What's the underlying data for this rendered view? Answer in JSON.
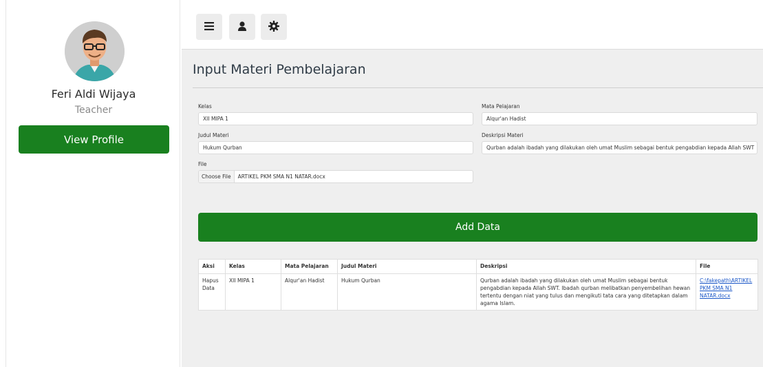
{
  "sidebar": {
    "user_name": "Feri Aldi Wijaya",
    "user_role": "Teacher",
    "view_profile_label": "View Profile",
    "avatar_icon": "cartoon-man-avatar"
  },
  "topbar": {
    "buttons": [
      {
        "icon": "hamburger-menu-icon"
      },
      {
        "icon": "user-icon"
      },
      {
        "icon": "gear-icon"
      }
    ]
  },
  "page": {
    "title": "Input Materi Pembelajaran"
  },
  "form": {
    "kelas_label": "Kelas",
    "kelas_value": "XII MIPA 1",
    "mapel_label": "Mata Pelajaran",
    "mapel_value": "Alqur'an Hadist",
    "judul_label": "Judul Materi",
    "judul_value": "Hukum Qurban",
    "deskripsi_label": "Deskripsi Materi",
    "deskripsi_value": "Qurban adalah ibadah yang dilakukan oleh umat Muslim sebagai bentuk pengabdian kepada Allah SWT",
    "file_label": "File",
    "choose_file_label": "Choose File",
    "file_name": "ARTIKEL PKM SMA N1 NATAR.docx",
    "add_button_label": "Add Data"
  },
  "table": {
    "headers": [
      "Aksi",
      "Kelas",
      "Mata Pelajaran",
      "Judul Materi",
      "Deskripsi",
      "File"
    ],
    "rows": [
      {
        "aksi": "Hapus Data",
        "kelas": "XII MIPA 1",
        "mapel": "Alqur'an Hadist",
        "judul": "Hukum Qurban",
        "deskripsi": "Qurban adalah ibadah yang dilakukan oleh umat Muslim sebagai bentuk pengabdian kepada Allah SWT. Ibadah qurban melibatkan penyembelihan hewan tertentu dengan niat yang tulus dan mengikuti tata cara yang ditetapkan dalam agama Islam.",
        "file": "C:\\fakepath\\ARTIKEL PKM SMA N1 NATAR.docx"
      }
    ]
  },
  "colors": {
    "primary_green": "#19801f",
    "content_bg": "#efefef",
    "link_blue": "#1a56c7"
  }
}
